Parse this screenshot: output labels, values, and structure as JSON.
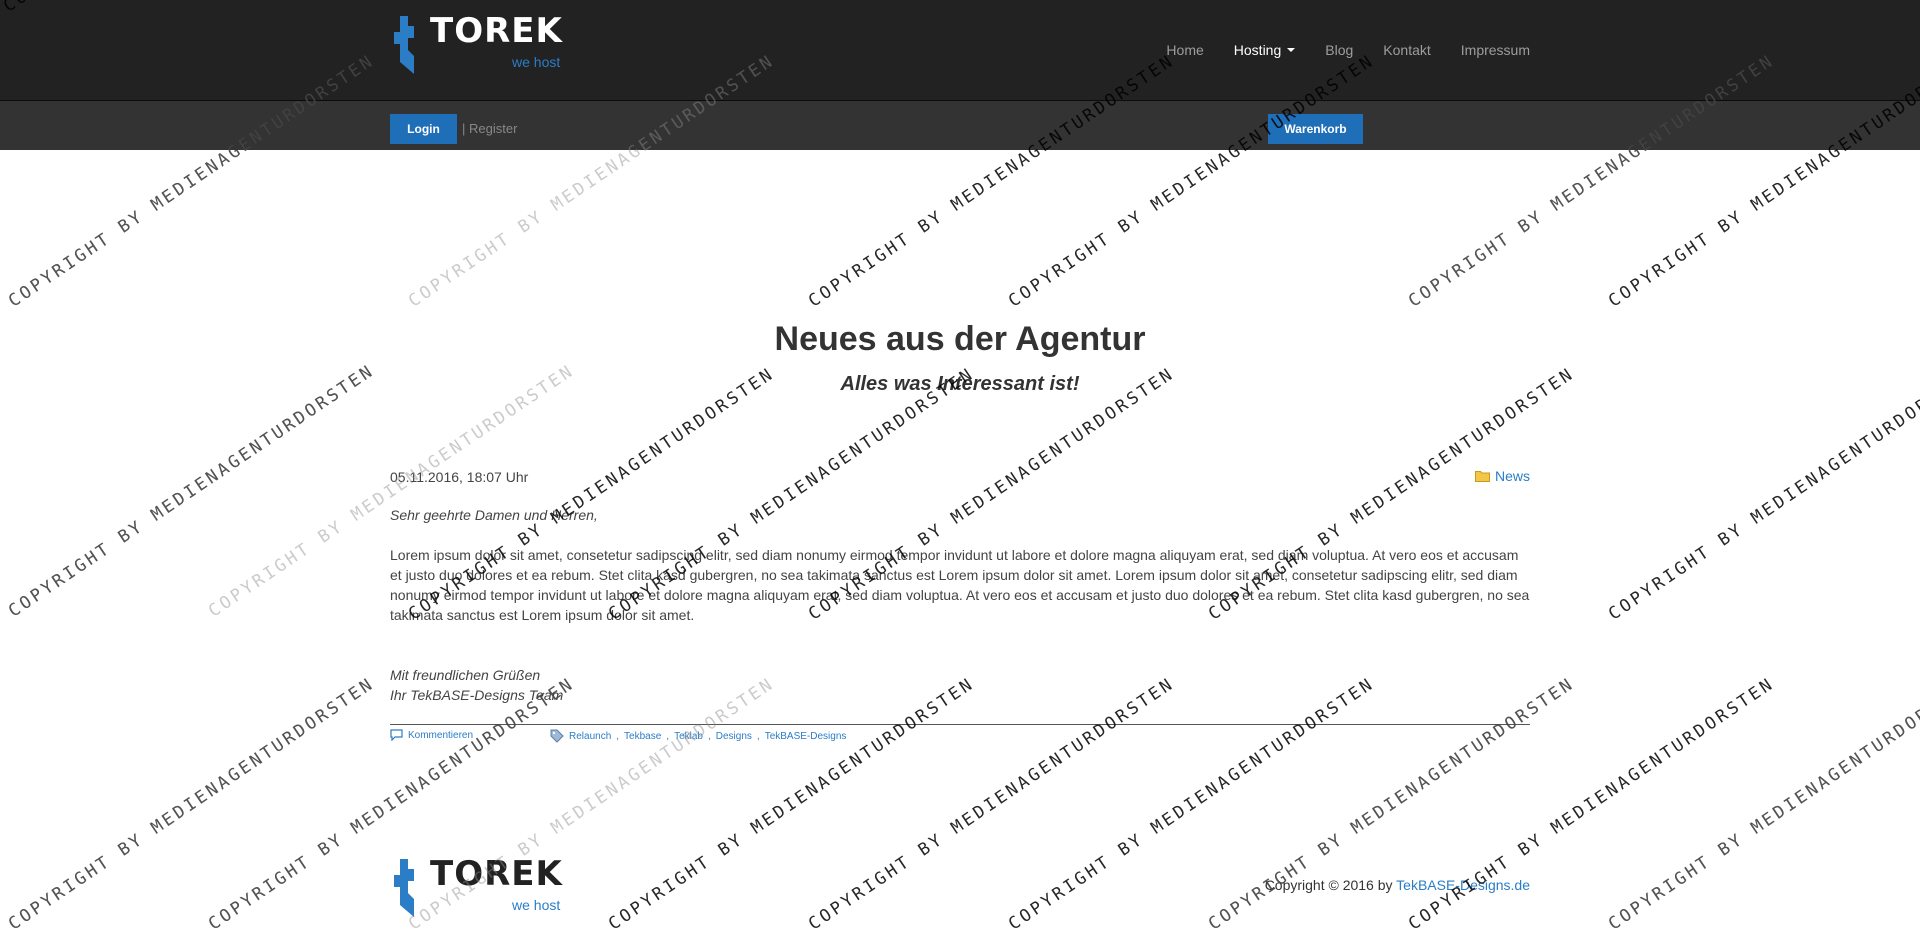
{
  "brand": {
    "name": "TOREK",
    "tagline": "we host"
  },
  "nav": {
    "items": [
      {
        "label": "Home"
      },
      {
        "label": "Hosting"
      },
      {
        "label": "Blog"
      },
      {
        "label": "Kontakt"
      },
      {
        "label": "Impressum"
      }
    ]
  },
  "subbar": {
    "login_label": "Login",
    "register_label": "| Register",
    "cart_label": "Warenkorb"
  },
  "main": {
    "title": "Neues aus der Agentur",
    "subtitle": "Alles was Interessant ist!"
  },
  "post": {
    "date": "05.11.2016, 18:07 Uhr",
    "category": "News",
    "greeting": "Sehr geehrte Damen und Herren,",
    "body": "Lorem ipsum dolor sit amet, consetetur sadipscing elitr, sed diam nonumy eirmod tempor invidunt ut labore et dolore magna aliquyam erat, sed diam voluptua. At vero eos et accusam et justo duo dolores et ea rebum. Stet clita kasd gubergren, no sea takimata sanctus est Lorem ipsum dolor sit amet. Lorem ipsum dolor sit amet, consetetur sadipscing elitr, sed diam nonumy eirmod tempor invidunt ut labore et dolore magna aliquyam erat, sed diam voluptua. At vero eos et accusam et justo duo dolores et ea rebum. Stet clita kasd gubergren, no sea takimata sanctus est Lorem ipsum dolor sit amet.",
    "signoff_line1": "Mit freundlichen Grüßen",
    "signoff_line2": "Ihr TekBASE-Designs Team",
    "comments_label": "Kommentieren",
    "tags": [
      {
        "label": "Relaunch"
      },
      {
        "label": "Tekbase"
      },
      {
        "label": "Teklab"
      },
      {
        "label": "Designs"
      },
      {
        "label": "TekBASE-Designs"
      }
    ]
  },
  "footer": {
    "copyright_prefix": "Copyright © 2016 by ",
    "copyright_link": "TekBASE-Designs.de"
  },
  "watermark": {
    "dark_text": "COPYRIGHT BY MEDIENAGENTURDORSTEN",
    "light_text": "COPYRIGHT BY MEDIENAGENTURDORSTEN"
  },
  "colors": {
    "navbar_bg": "#222222",
    "subbar_bg": "#333333",
    "accent": "#1f6fb8",
    "link": "#2b7dc6"
  },
  "icons": {
    "category": "folder-icon",
    "comments": "comment-icon",
    "tags": "tag-icon"
  }
}
